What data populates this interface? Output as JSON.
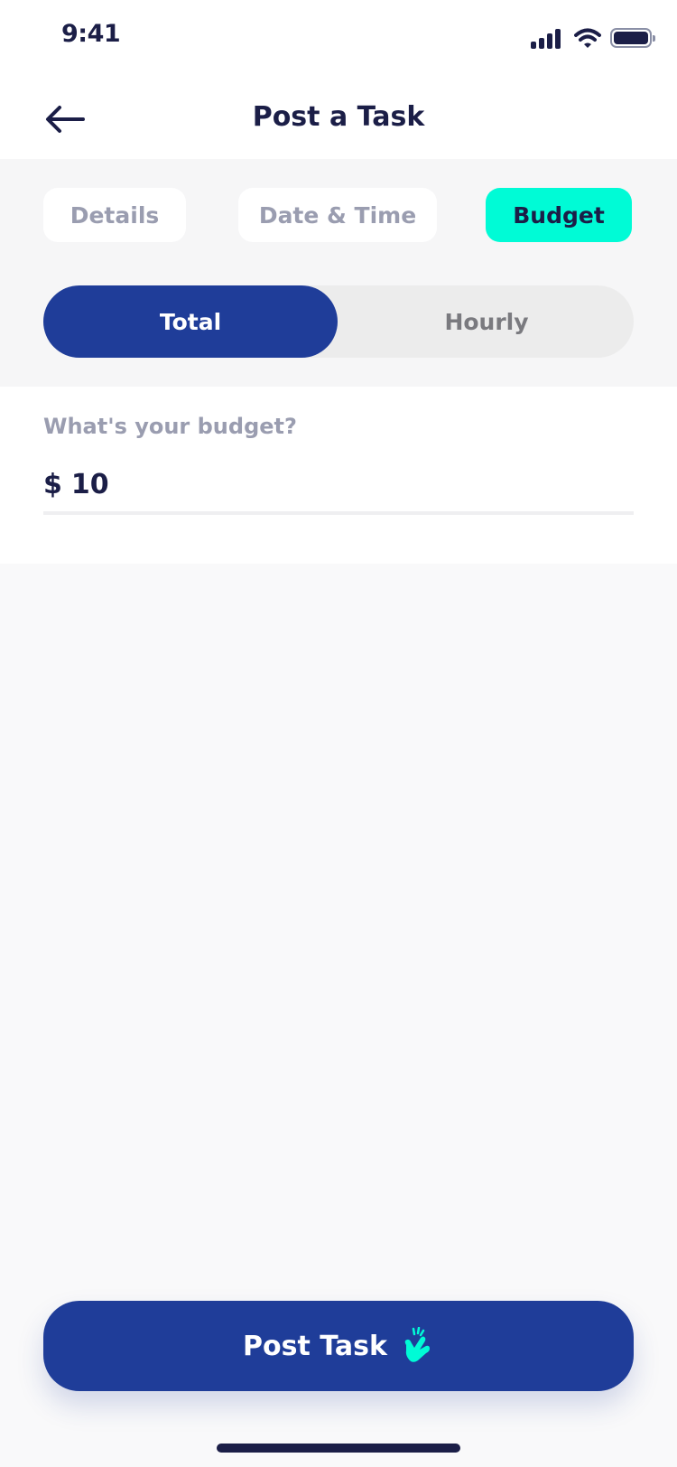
{
  "status_bar": {
    "time": "9:41",
    "icons": [
      "signal-icon",
      "wifi-icon",
      "battery-icon"
    ]
  },
  "nav": {
    "title": "Post a Task",
    "back_icon": "arrow-left-icon"
  },
  "steps": [
    {
      "label": "Details",
      "active": false
    },
    {
      "label": "Date & Time",
      "active": false
    },
    {
      "label": "Budget",
      "active": true
    }
  ],
  "budget_type": {
    "options": [
      {
        "label": "Total",
        "active": true
      },
      {
        "label": "Hourly",
        "active": false
      }
    ]
  },
  "budget": {
    "label": "What's your budget?",
    "currency": "$",
    "value": "10"
  },
  "post_button": {
    "label": "Post Task",
    "icon": "snap-hand-icon"
  },
  "colors": {
    "primary": "#1f3d99",
    "accent": "#00fbd6",
    "text_dark": "#1b1e47",
    "text_muted": "#9a9db0",
    "background": "#f9f9fa"
  }
}
